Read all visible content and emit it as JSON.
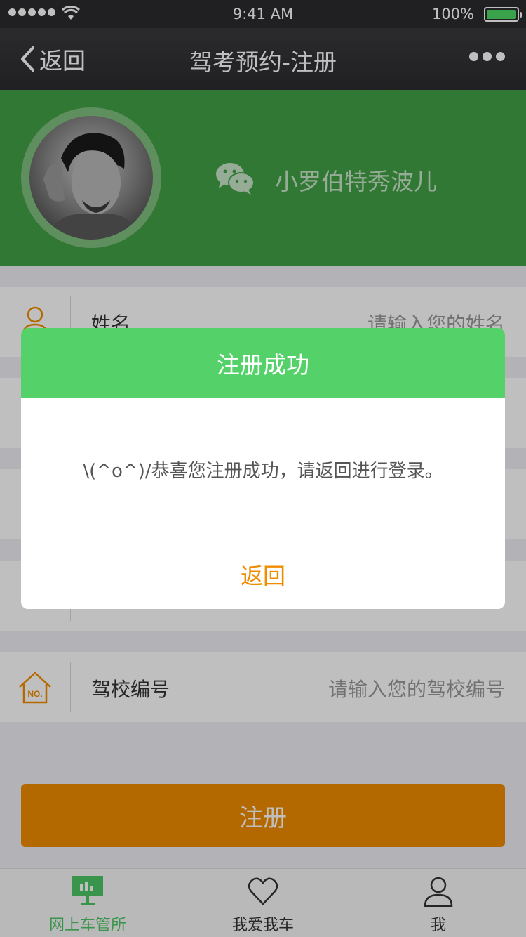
{
  "status_bar": {
    "time": "9:41 AM",
    "battery": "100%"
  },
  "nav": {
    "back_label": "返回",
    "title": "驾考预约-注册"
  },
  "profile": {
    "nickname": "小罗伯特秀波儿"
  },
  "form": {
    "fields": [
      {
        "label": "姓名",
        "placeholder": "请输入您的姓名",
        "icon": "person-icon"
      },
      {
        "label": "驾校编号",
        "placeholder": "请输入您的驾校编号",
        "icon": "house-no-icon"
      }
    ],
    "submit_label": "注册"
  },
  "tabs": [
    {
      "label": "网上车管所",
      "icon": "chart-board-icon",
      "active": true
    },
    {
      "label": "我爱我车",
      "icon": "heart-icon",
      "active": false
    },
    {
      "label": "我",
      "icon": "user-icon",
      "active": false
    }
  ],
  "dialog": {
    "title": "注册成功",
    "message": "\\(^o^)/恭喜您注册成功，请返回进行登录。",
    "button_label": "返回"
  },
  "colors": {
    "nav_bg": "#2b2b2f",
    "profile_bg": "#43a047",
    "accent_orange": "#f08c00",
    "dialog_header": "#55d16a",
    "tab_active": "#4cc764"
  }
}
